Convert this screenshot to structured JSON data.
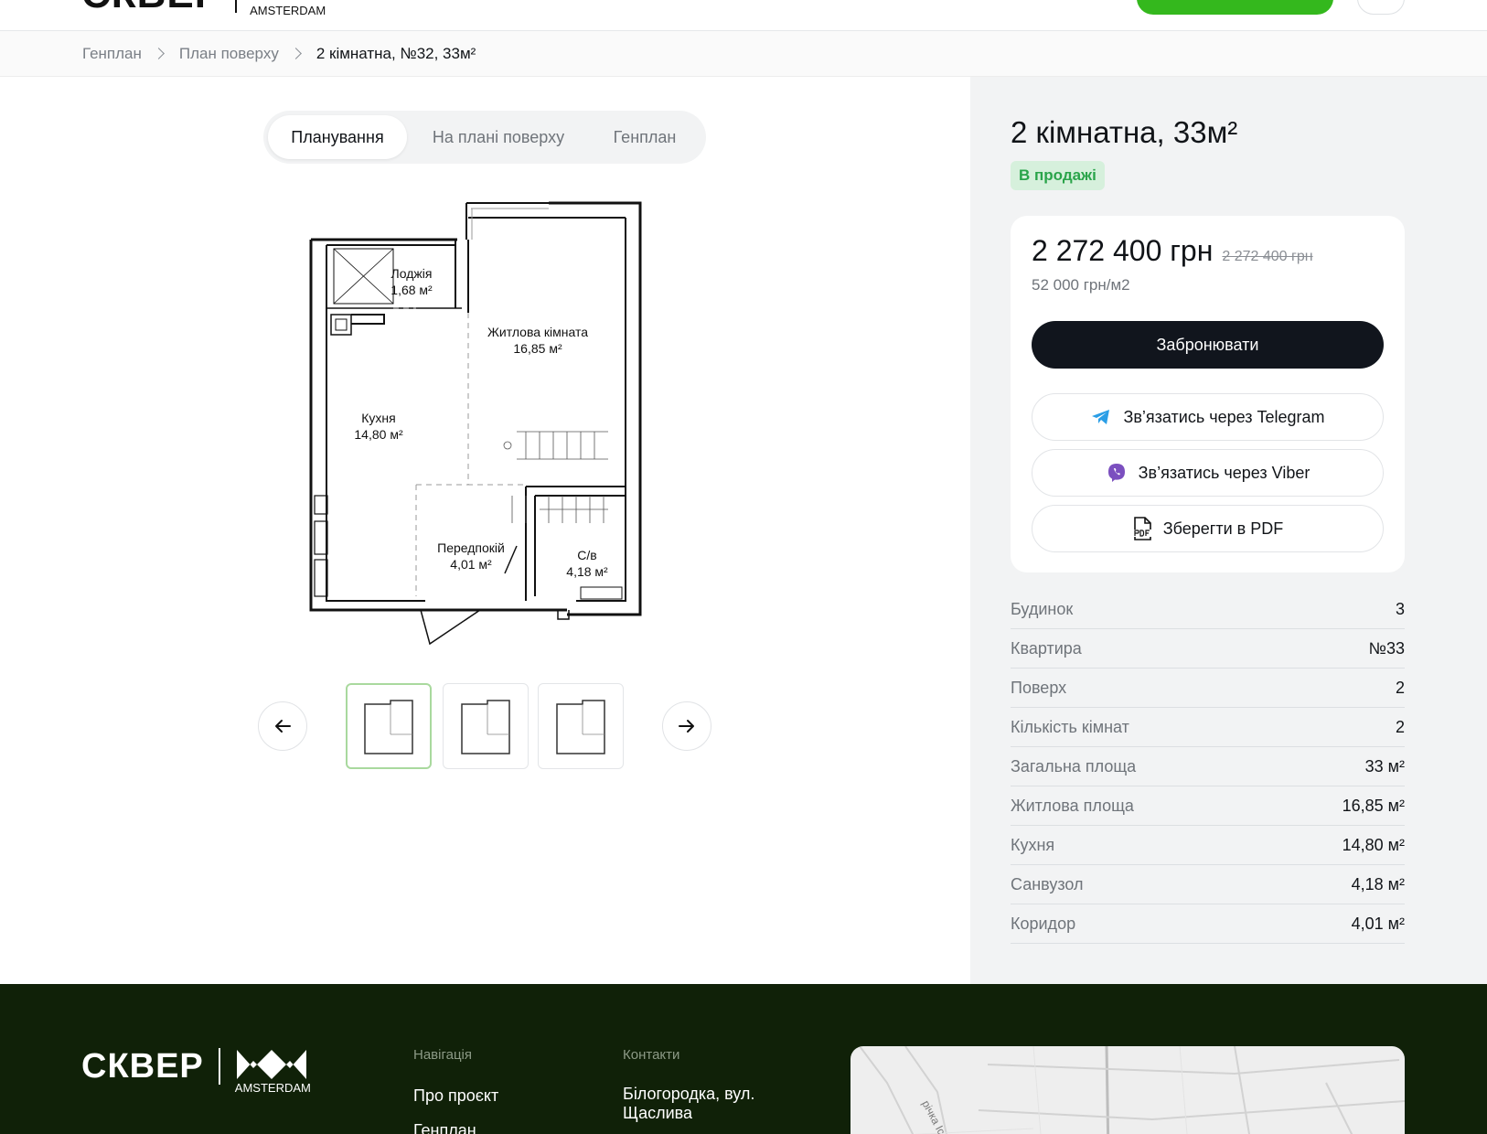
{
  "header": {
    "logo_text": "СКВЕР",
    "logo_sub": "AMSTERDAM"
  },
  "breadcrumb": {
    "items": [
      "Генплан",
      "План поверху",
      "2 кімнатна, №32, 33м²"
    ]
  },
  "view_tabs": {
    "items": [
      "Планування",
      "На  плані поверху",
      "Генплан"
    ],
    "active": 0
  },
  "floorplan": {
    "rooms": [
      {
        "name": "Лоджія",
        "area": "1,68 м²"
      },
      {
        "name": "Житлова кімната",
        "area": "16,85 м²"
      },
      {
        "name": "Кухня",
        "area": "14,80 м²"
      },
      {
        "name": "Передпокій",
        "area": "4,01 м²"
      },
      {
        "name": "С/в",
        "area": "4,18 м²"
      }
    ]
  },
  "gallery": {
    "count": 3,
    "selected": 0
  },
  "listing": {
    "title": "2 кімнатна,  33м²",
    "status": "В продажі",
    "price": "2 272 400 грн",
    "old_price": "2 272 400 грн",
    "price_per_m2": "52 000 грн/м2",
    "book_label": "Забронювати",
    "telegram_label": "Зв’язатись через Telegram",
    "viber_label": "Зв’язатись через Viber",
    "pdf_label": "Зберегти в PDF",
    "specs": [
      {
        "label": "Будинок",
        "value": "3"
      },
      {
        "label": "Квартира",
        "value": "№33"
      },
      {
        "label": "Поверх",
        "value": "2"
      },
      {
        "label": "Кількість кімнат",
        "value": "2"
      },
      {
        "label": "Загальна площа",
        "value": "33 м²"
      },
      {
        "label": "Житлова площа",
        "value": "16,85 м²"
      },
      {
        "label": "Кухня",
        "value": "14,80 м²"
      },
      {
        "label": "Санвузол",
        "value": "4,18 м²"
      },
      {
        "label": "Коридор",
        "value": "4,01 м²"
      }
    ]
  },
  "footer": {
    "logo_text": "СКВЕР",
    "logo_sub": "AMSTERDAM",
    "nav_heading": "Навігація",
    "nav_links": [
      "Про проєкт",
      "Генплан"
    ],
    "contacts_heading": "Контакти",
    "address_line1": "Білогородка, вул.",
    "address_line2": "Щаслива",
    "map_label": "річка Іс"
  },
  "colors": {
    "accent_green": "#34b81d",
    "status_green": "#2aa44a",
    "footer_bg": "#102108",
    "dark_button": "#11151d"
  },
  "icons": [
    "arrow-left-icon",
    "arrow-right-icon",
    "chevron-right-icon",
    "telegram-icon",
    "viber-icon",
    "pdf-icon"
  ]
}
